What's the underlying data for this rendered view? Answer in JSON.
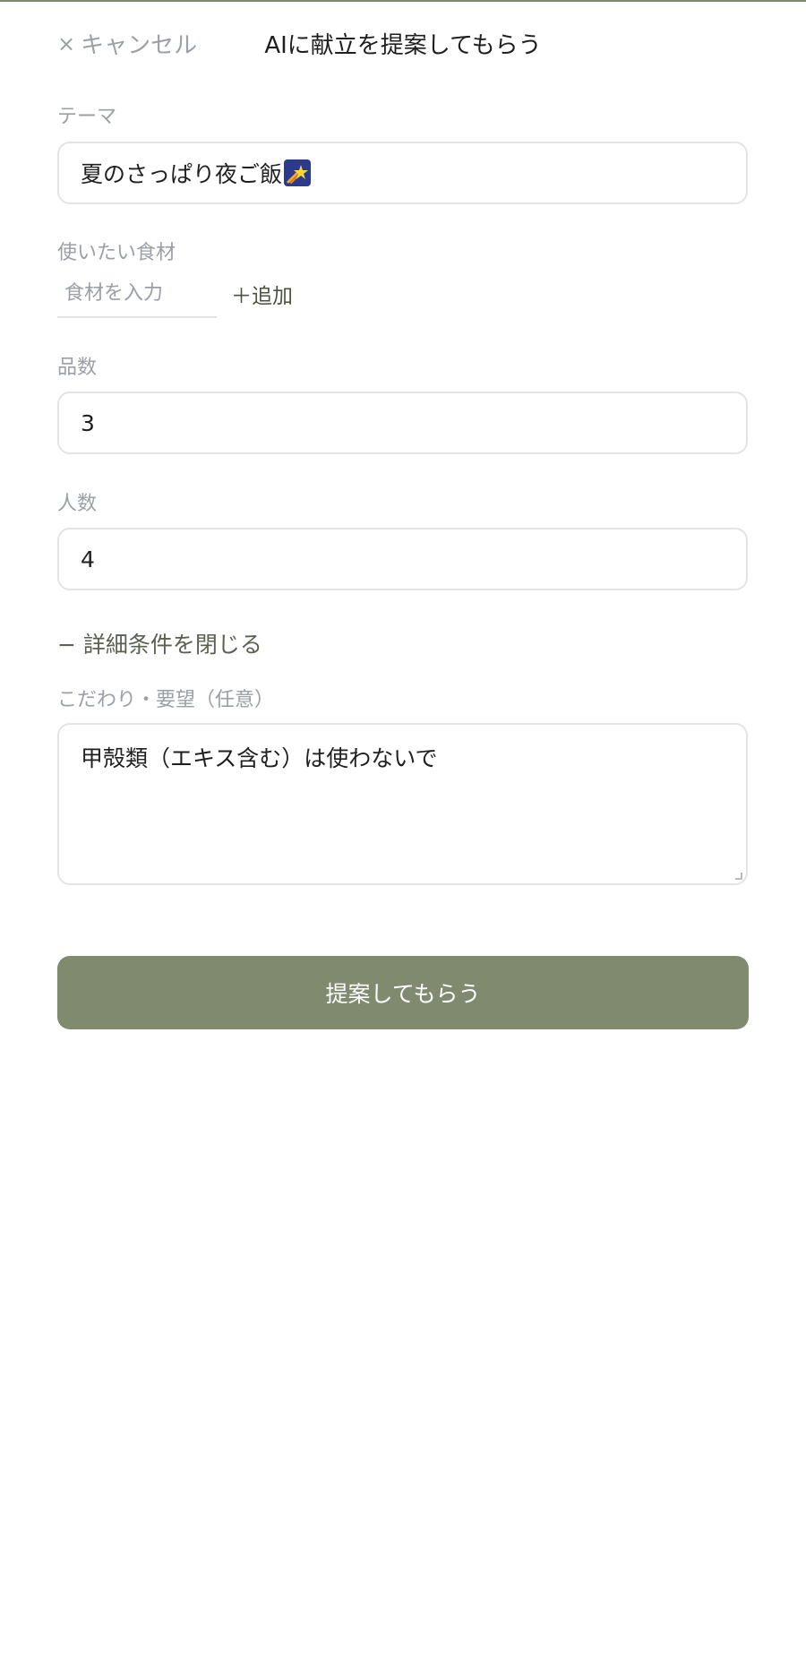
{
  "header": {
    "cancel_label": "キャンセル",
    "title": "AIに献立を提案してもらう"
  },
  "theme": {
    "label": "テーマ",
    "value": "夏のさっぱり夜ご飯"
  },
  "ingredients": {
    "label": "使いたい食材",
    "placeholder": "食材を入力",
    "add_label": "＋追加"
  },
  "dish_count": {
    "label": "品数",
    "value": "3"
  },
  "people_count": {
    "label": "人数",
    "value": "4"
  },
  "details": {
    "toggle_label": "− 詳細条件を閉じる",
    "preferences_label": "こだわり・要望（任意）",
    "preferences_value": "甲殻類（エキス含む）は使わないで"
  },
  "submit": {
    "label": "提案してもらう"
  },
  "colors": {
    "accent": "#7f8a6f",
    "muted_text": "#9aa0a6",
    "border": "#e2e4e6"
  },
  "icons": {
    "cancel": "close-icon",
    "theme_emoji": "shooting-star-icon"
  }
}
